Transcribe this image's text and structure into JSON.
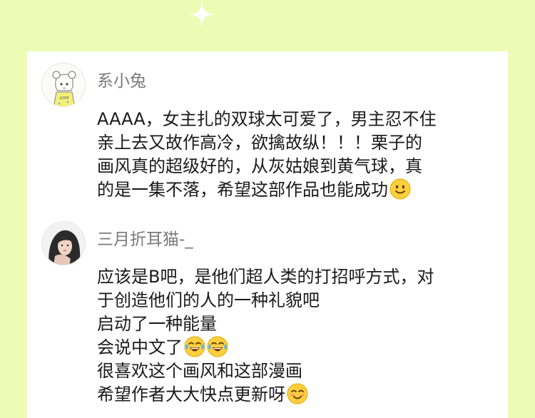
{
  "comments": [
    {
      "username": "系小兔",
      "avatar": "girl-sketch-avatar",
      "lines": [
        "AAAA，女主扎的双球太可爱了，男主忍不住",
        "亲上去又故作高冷，欲擒故纵！！！栗子的",
        "画风真的超级好的，从灰姑娘到黄气球，真",
        "的是一集不落，希望这部作品也能成功"
      ],
      "emojis": [
        "smiling-face-emoji"
      ]
    },
    {
      "username": "三月折耳猫-_",
      "avatar": "girl-photo-avatar",
      "lines": [
        "应该是B吧，是他们超人类的打招呼方式，对",
        "于创造他们的人的一种礼貌吧",
        "启动了一种能量",
        "会说中文了",
        "很喜欢这个画风和这部漫画",
        "希望作者大大快点更新呀"
      ],
      "emojis": [
        "tears-of-joy-emoji",
        "tears-of-joy-emoji",
        "blushing-smile-emoji"
      ]
    }
  ],
  "colors": {
    "background": "#eefbb5",
    "card": "#ffffff",
    "username": "#7a7a7a",
    "text": "#1a1a1a"
  }
}
